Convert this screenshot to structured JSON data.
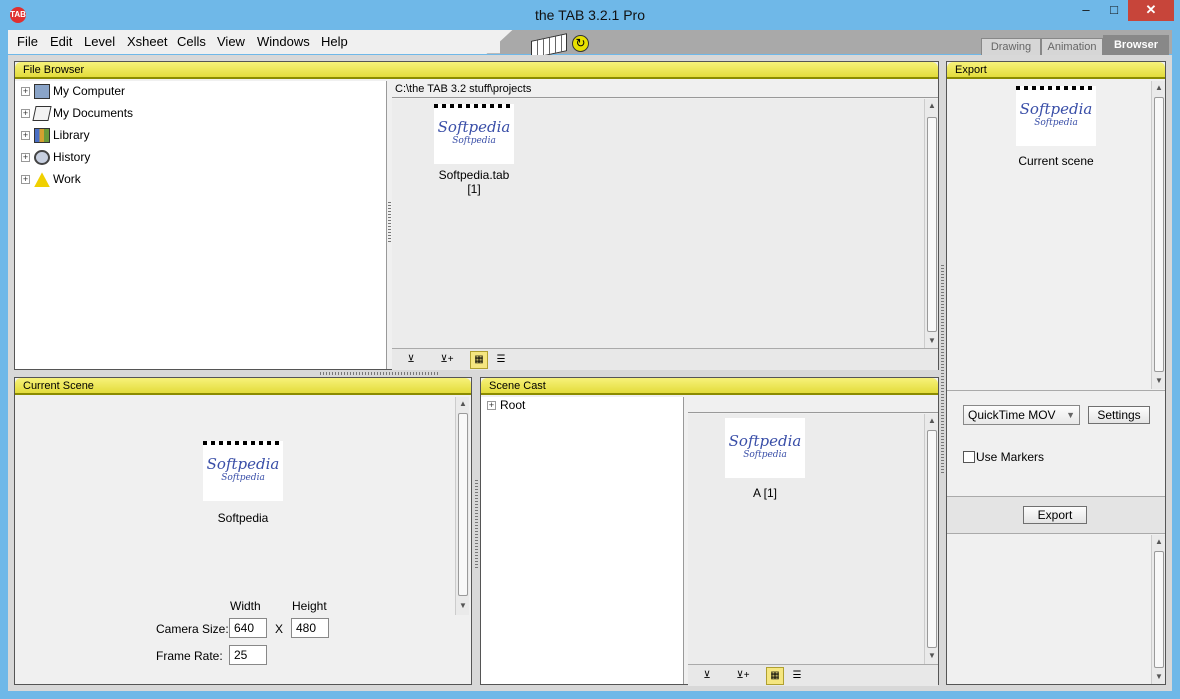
{
  "window": {
    "title": "the TAB 3.2.1 Pro",
    "icon_text": "TAB",
    "minimize": "–",
    "maximize": "□",
    "close": "✕"
  },
  "menu": [
    "File",
    "Edit",
    "Level",
    "Xsheet",
    "Cells",
    "View",
    "Windows",
    "Help"
  ],
  "rooms": {
    "drawing": "Drawing",
    "animation": "Animation",
    "browser": "Browser",
    "active": "Browser"
  },
  "file_browser": {
    "title": "File Browser",
    "tree": [
      {
        "label": "My Computer",
        "icon": "computer-icon"
      },
      {
        "label": "My Documents",
        "icon": "documents-icon"
      },
      {
        "label": "Library",
        "icon": "library-icon"
      },
      {
        "label": "History",
        "icon": "history-icon"
      },
      {
        "label": "Work",
        "icon": "work-icon"
      }
    ],
    "path": "C:\\the TAB 3.2 stuff\\projects",
    "files": [
      {
        "name": "Softpedia.tab",
        "frames": "[1]"
      }
    ],
    "view_mode": "icons"
  },
  "current_scene": {
    "title": "Current Scene",
    "scene_name": "Softpedia",
    "width_label": "Width",
    "height_label": "Height",
    "camera_size_label": "Camera Size:",
    "camera_width": "640",
    "x_label": "X",
    "camera_height": "480",
    "frame_rate_label": "Frame Rate:",
    "frame_rate": "25"
  },
  "scene_cast": {
    "title": "Scene Cast",
    "root": "Root",
    "items": [
      {
        "name": "A [1]"
      }
    ]
  },
  "export": {
    "title": "Export",
    "scene_label": "Current scene",
    "format": "QuickTime MOV",
    "settings_label": "Settings",
    "use_markers_label": "Use Markers",
    "use_markers": false,
    "export_label": "Export"
  },
  "thumbnail_text": {
    "main": "Softpedia",
    "sub": "Softpedia"
  },
  "colors": {
    "panel_header": "#e8e04a",
    "title_bar": "#6fb8e8",
    "close_button": "#c7453a",
    "selected_tool": "#f5e680"
  }
}
